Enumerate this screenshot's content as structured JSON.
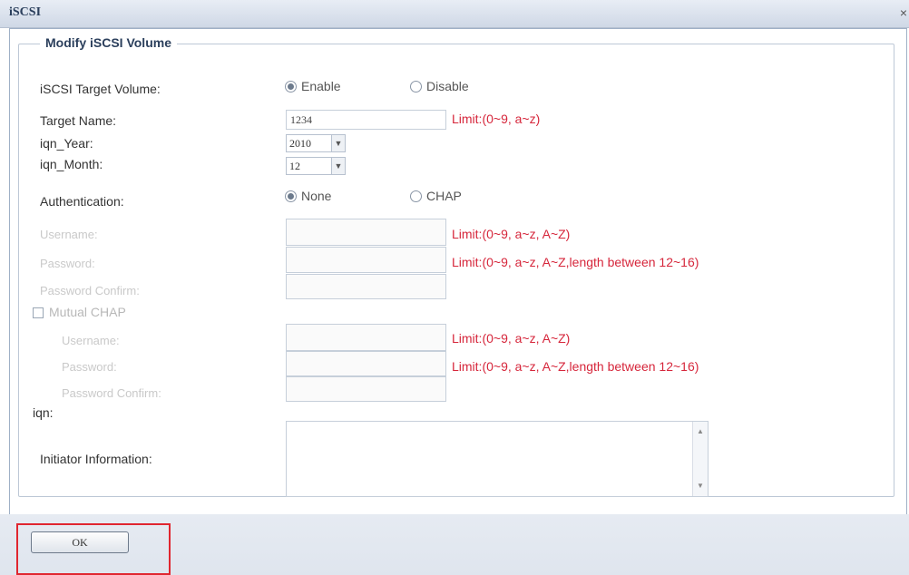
{
  "window": {
    "title": "iSCSI",
    "close_glyph": "×"
  },
  "section_title": "Modify iSCSI Volume",
  "target_volume": {
    "label": "iSCSI Target Volume:",
    "options": [
      "Enable",
      "Disable"
    ],
    "selected": "Enable"
  },
  "target_name": {
    "label": "Target Name:",
    "value": "1234",
    "limit": "Limit:(0~9, a~z)"
  },
  "iqn_year": {
    "label": "iqn_Year:",
    "value": "2010"
  },
  "iqn_month": {
    "label": "iqn_Month:",
    "value": "12"
  },
  "authentication": {
    "label": "Authentication:",
    "options": [
      "None",
      "CHAP"
    ],
    "selected": "None"
  },
  "chap": {
    "username_label": "Username:",
    "password_label": "Password:",
    "password_confirm_label": "Password Confirm:",
    "username_limit": "Limit:(0~9, a~z, A~Z)",
    "password_limit": "Limit:(0~9, a~z, A~Z,length between 12~16)"
  },
  "mutual_chap": {
    "label": "Mutual CHAP",
    "checked": false,
    "username_label": "Username:",
    "password_label": "Password:",
    "password_confirm_label": "Password Confirm:",
    "username_limit": "Limit:(0~9, a~z, A~Z)",
    "password_limit": "Limit:(0~9, a~z, A~Z,length between 12~16)"
  },
  "iqn": {
    "label": "iqn:"
  },
  "initiator": {
    "label": "Initiator Information:"
  },
  "ok_button": "OK",
  "colors": {
    "limit_text": "#d6263b",
    "highlight_box": "#e0262f",
    "header_text": "#2b3f5c"
  }
}
